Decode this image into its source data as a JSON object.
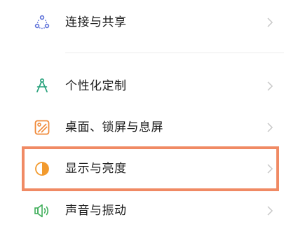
{
  "settings": {
    "items": [
      {
        "label": "连接与共享",
        "icon": "connection-share-icon",
        "icon_color": "#5b6fd8"
      },
      {
        "label": "个性化定制",
        "icon": "compass-personalize-icon",
        "icon_color": "#26a17b"
      },
      {
        "label": "桌面、锁屏与息屏",
        "icon": "wallpaper-icon",
        "icon_color": "#f08a3a"
      },
      {
        "label": "显示与亮度",
        "icon": "brightness-icon",
        "icon_color": "#f29a2e"
      },
      {
        "label": "声音与振动",
        "icon": "sound-vibration-icon",
        "icon_color": "#3fae5a"
      }
    ]
  },
  "colors": {
    "highlight_border": "#f08a64",
    "chevron": "#c8c8c8"
  }
}
